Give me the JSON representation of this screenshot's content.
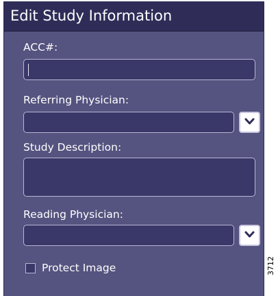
{
  "dialog": {
    "title": "Edit Study Information"
  },
  "fields": {
    "acc": {
      "label": "ACC#:",
      "value": ""
    },
    "referring_physician": {
      "label": "Referring Physician:",
      "value": ""
    },
    "study_description": {
      "label": "Study Description:",
      "value": ""
    },
    "reading_physician": {
      "label": "Reading Physician:",
      "value": ""
    }
  },
  "protect_image": {
    "label": "Protect Image",
    "checked": false
  },
  "figure_id": "3712",
  "icons": {
    "dropdown": "chevron-down-icon"
  },
  "colors": {
    "panel": "#55537f",
    "titlebar": "#2f2d58",
    "field": "#3a3868"
  }
}
